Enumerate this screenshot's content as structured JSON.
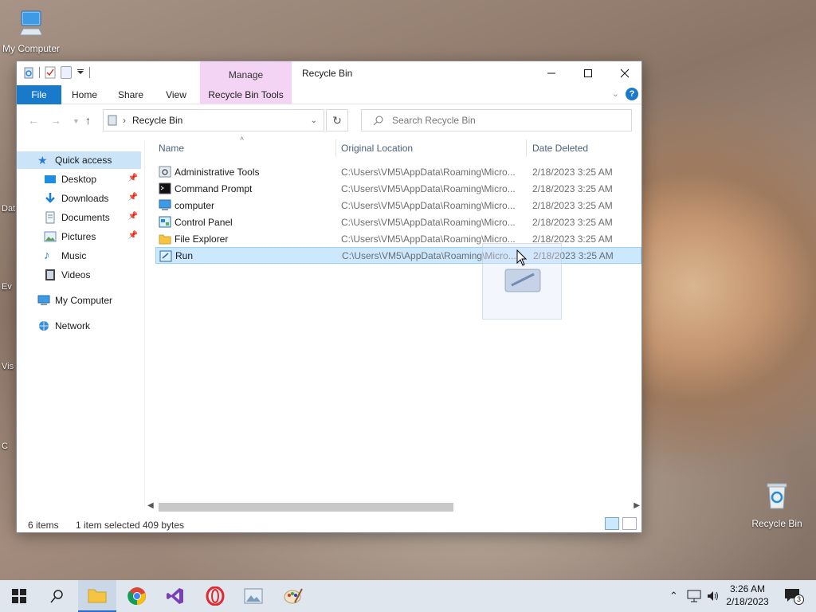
{
  "desktop": {
    "my_computer_label": "My Computer",
    "recycle_bin_label": "Recycle Bin",
    "edge_labels": [
      "Dat",
      "Ev",
      "Vis",
      "C"
    ]
  },
  "window": {
    "title": "Recycle Bin",
    "manage_label": "Manage",
    "ribbon_tabs": {
      "file": "File",
      "home": "Home",
      "share": "Share",
      "view": "View",
      "tools": "Recycle Bin Tools"
    },
    "help": "?"
  },
  "address": {
    "path": "Recycle Bin",
    "search_placeholder": "Search Recycle Bin"
  },
  "nav": {
    "quick_access": "Quick access",
    "desktop": "Desktop",
    "downloads": "Downloads",
    "documents": "Documents",
    "pictures": "Pictures",
    "music": "Music",
    "videos": "Videos",
    "my_computer": "My Computer",
    "network": "Network"
  },
  "columns": {
    "name": "Name",
    "location": "Original Location",
    "date": "Date Deleted"
  },
  "files": [
    {
      "name": "Administrative Tools",
      "location": "C:\\Users\\VM5\\AppData\\Roaming\\Micro...",
      "date": "2/18/2023 3:25 AM"
    },
    {
      "name": "Command Prompt",
      "location": "C:\\Users\\VM5\\AppData\\Roaming\\Micro...",
      "date": "2/18/2023 3:25 AM"
    },
    {
      "name": "computer",
      "location": "C:\\Users\\VM5\\AppData\\Roaming\\Micro...",
      "date": "2/18/2023 3:25 AM"
    },
    {
      "name": "Control Panel",
      "location": "C:\\Users\\VM5\\AppData\\Roaming\\Micro...",
      "date": "2/18/2023 3:25 AM"
    },
    {
      "name": "File Explorer",
      "location": "C:\\Users\\VM5\\AppData\\Roaming\\Micro...",
      "date": "2/18/2023 3:25 AM"
    },
    {
      "name": "Run",
      "location": "C:\\Users\\VM5\\AppData\\Roaming\\Micro...",
      "date": "2/18/2023 3:25 AM"
    }
  ],
  "status": {
    "count": "6 items",
    "selected": "1 item selected",
    "size": "409 bytes"
  },
  "taskbar": {
    "time": "3:26 AM",
    "date": "2/18/2023",
    "notifications": "3"
  },
  "colors": {
    "accent": "#1979ca",
    "manage_tab": "#f4d4f4",
    "selection": "#cce8ff"
  }
}
